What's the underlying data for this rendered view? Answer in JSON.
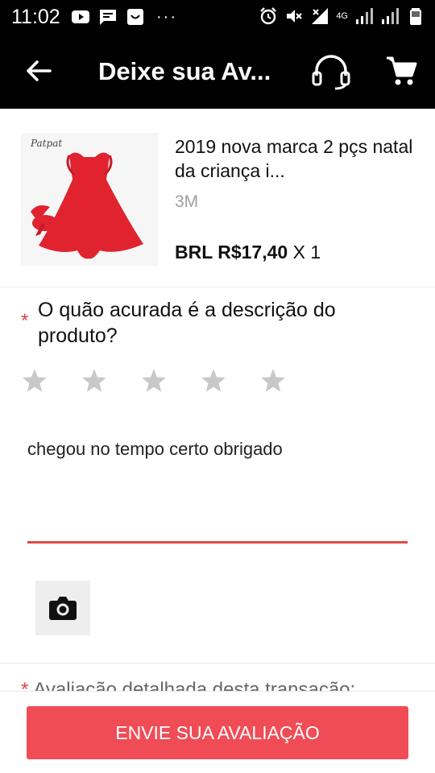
{
  "status_bar": {
    "time": "11:02",
    "network_label": "4G"
  },
  "app_bar": {
    "title": "Deixe sua Av..."
  },
  "product": {
    "thumb_brand": "Patpat",
    "name": "2019 nova marca 2 pçs natal da criança i...",
    "variant": "3M",
    "price": "BRL R$17,40",
    "quantity": "X 1"
  },
  "question": {
    "required_mark": "*",
    "text": "O quão acurada é a descrição do produto?",
    "rating": 0,
    "max_rating": 5
  },
  "review": {
    "text": "chegou no tempo certo obrigado"
  },
  "detail": {
    "required_mark": "*",
    "label": "Avaliação detalhada desta transação:"
  },
  "submit": {
    "label": "ENVIE SUA AVALIAÇÃO"
  },
  "colors": {
    "accent": "#f04c55",
    "star_empty": "#c8c8c8"
  }
}
